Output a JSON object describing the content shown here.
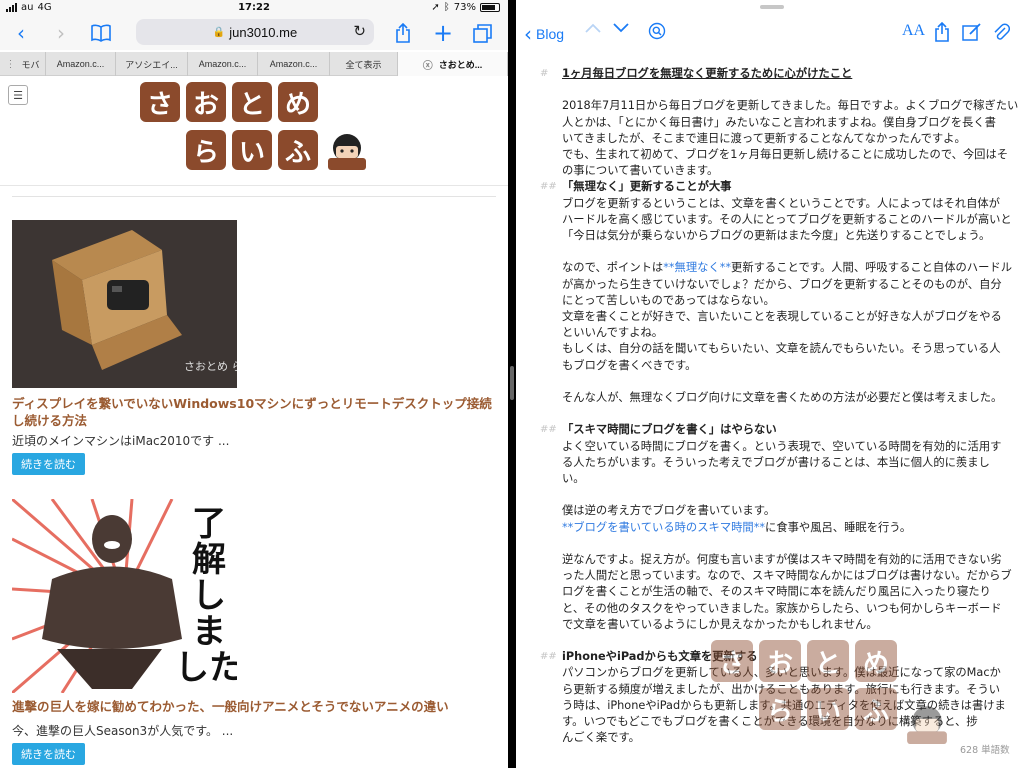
{
  "status_bar": {
    "carrier": "au",
    "network": "4G",
    "time": "17:22",
    "battery": "73%"
  },
  "safari": {
    "url": "jun3010.me",
    "tabs": [
      {
        "label": "モバ",
        "active": false
      },
      {
        "label": "Amazon.c...",
        "active": false
      },
      {
        "label": "アソシエイ...",
        "active": false
      },
      {
        "label": "Amazon.c...",
        "active": false
      },
      {
        "label": "Amazon.c...",
        "active": false
      },
      {
        "label": "全て表示",
        "active": false
      },
      {
        "label": "さおとめ...",
        "active": true
      }
    ],
    "logo": {
      "text": "さおとめらいふ"
    },
    "posts": [
      {
        "image_caption": "さおとめ らいふ",
        "title": "ディスプレイを繋いでいないWindows10マシンにずっとリモートデスクトップ接続し続ける方法",
        "excerpt": "近頃のメインマシンはiMac2010です ...",
        "more_label": "続きを読む"
      },
      {
        "image_caption": "了解しました",
        "title": "進撃の巨人を嫁に勧めてわかった、一般向けアニメとそうでないアニメの違い",
        "excerpt": "今、進撃の巨人Season3が人気です。 ...",
        "more_label": "続きを読む"
      }
    ]
  },
  "editor": {
    "back_label": "Blog",
    "font_button": "AA",
    "heading_marker": "#",
    "subheading_marker": "##",
    "lines": [
      {
        "type": "h1",
        "text": "1ヶ月毎日ブログを無理なく更新するために心がけたこと"
      },
      {
        "type": "blank"
      },
      {
        "type": "p",
        "text": "2018年7月11日から毎日ブログを更新してきました。毎日ですよ。よくブログで稼ぎたい"
      },
      {
        "type": "p",
        "text": "人とかは、「とにかく毎日書け」みたいなこと言われますよね。僕自身ブログを長く書"
      },
      {
        "type": "p",
        "text": "いてきましたが、そこまで連日に渡って更新することなんてなかったんですよ。"
      },
      {
        "type": "p",
        "text": "でも、生まれて初めて、ブログを1ヶ月毎日更新し続けることに成功したので、今回はそ"
      },
      {
        "type": "p",
        "text": "の事について書いていきます。"
      },
      {
        "type": "h2",
        "text": "「無理なく」更新することが大事"
      },
      {
        "type": "p",
        "text": "ブログを更新するということは、文章を書くということです。人によってはそれ自体が"
      },
      {
        "type": "p",
        "text": "ハードルを高く感じています。その人にとってブログを更新することのハードルが高いと"
      },
      {
        "type": "p",
        "text": "「今日は気分が乗らないからブログの更新はまた今度」と先送りすることでしょう。"
      },
      {
        "type": "blank"
      },
      {
        "type": "link",
        "before": "なので、ポイントは",
        "link": "**無理なく**",
        "after": "更新することです。人間、呼吸すること自体のハードル"
      },
      {
        "type": "p",
        "text": "が高かったら生きていけないでしょ？だから、ブログを更新することそのものが、自分"
      },
      {
        "type": "p",
        "text": "にとって苦しいものであってはならない。"
      },
      {
        "type": "p",
        "text": "文章を書くことが好きで、言いたいことを表現していることが好きな人がブログをやる"
      },
      {
        "type": "p",
        "text": "といいんですよね。"
      },
      {
        "type": "p",
        "text": "もしくは、自分の話を聞いてもらいたい、文章を読んでもらいたい。そう思っている人"
      },
      {
        "type": "p",
        "text": "もブログを書くべきです。"
      },
      {
        "type": "blank"
      },
      {
        "type": "p",
        "text": "そんな人が、無理なくブログ向けに文章を書くための方法が必要だと僕は考えました。"
      },
      {
        "type": "blank"
      },
      {
        "type": "h2",
        "text": "「スキマ時間にブログを書く」はやらない"
      },
      {
        "type": "p",
        "text": "よく空いている時間にブログを書く。という表現で、空いている時間を有効的に活用す"
      },
      {
        "type": "p",
        "text": "る人たちがいます。そういった考えでブログが書けることは、本当に個人的に羨まし"
      },
      {
        "type": "p",
        "text": "い。"
      },
      {
        "type": "blank"
      },
      {
        "type": "p",
        "text": "僕は逆の考え方でブログを書いています。"
      },
      {
        "type": "link",
        "before": "",
        "link": "**ブログを書いている時のスキマ時間**",
        "after": "に食事や風呂、睡眠を行う。"
      },
      {
        "type": "blank"
      },
      {
        "type": "p",
        "text": "逆なんですよ。捉え方が。何度も言いますが僕はスキマ時間を有効的に活用できない劣"
      },
      {
        "type": "p",
        "text": "った人間だと思っています。なので、スキマ時間なんかにはブログは書けない。だからブ"
      },
      {
        "type": "p",
        "text": "ログを書くことが生活の軸で、そのスキマ時間に本を読んだり風呂に入ったり寝たり"
      },
      {
        "type": "p",
        "text": "と、その他のタスクをやっていきました。家族からしたら、いつも何かしらキーボード"
      },
      {
        "type": "p",
        "text": "で文章を書いているようにしか見えなかったかもしれません。"
      },
      {
        "type": "blank"
      },
      {
        "type": "h2",
        "text": "iPhoneやiPadからも文章を更新する"
      },
      {
        "type": "p",
        "text": "パソコンからブログを更新している人、多いと思います。僕は最近になって家のMacか"
      },
      {
        "type": "p",
        "text": "ら更新する頻度が増えましたが、出かけることもあります。旅行にも行きます。そうい"
      },
      {
        "type": "p",
        "text": "う時は、iPhoneやiPadからも更新します。共通のエディタを使えば文章の続きは書けま"
      },
      {
        "type": "p",
        "text": "す。いつでもどこでもブログを書くことができる環境を自分なりに構築すると、捗"
      },
      {
        "type": "p",
        "text": "んごく楽です。"
      }
    ],
    "word_count": "628 単語数",
    "watermark_text": "さおとめ"
  },
  "colors": {
    "ios_blue": "#1a7bf5",
    "brand_brown": "#8b4a2c",
    "title_brown": "#9b5b32",
    "more_button": "#29a7e1"
  }
}
